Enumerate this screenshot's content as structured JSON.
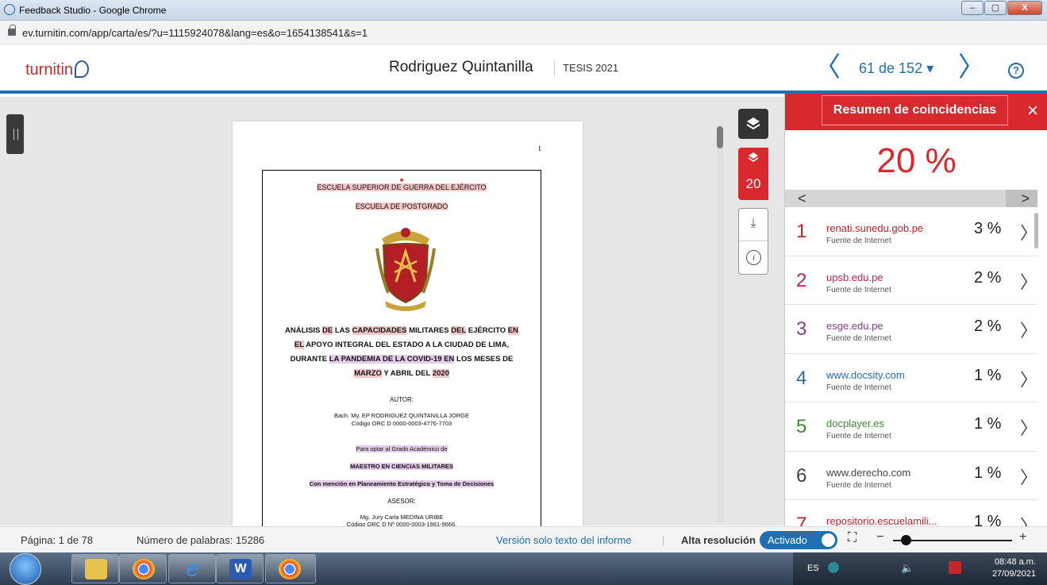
{
  "browser": {
    "window_title": "Feedback Studio - Google Chrome",
    "url": "ev.turnitin.com/app/carta/es/?u=1115924078&lang=es&o=1654138541&s=1",
    "minimize": "–",
    "maximize": "▢",
    "close": "X"
  },
  "header": {
    "logo_text": "turnitin",
    "doc_title": "Rodriguez Quintanilla",
    "doc_subtitle": "TESIS 2021",
    "prev": "〈",
    "next": "〉",
    "page_counter": "61 de 152 ▾",
    "help": "?"
  },
  "document": {
    "page_number": "1",
    "lines": {
      "school": "ESCUELA SUPERIOR DE GUERRA DEL EJÉRCITO",
      "postgrado": "ESCUELA DE POSTGRADO",
      "title1a": "ANÁLISIS ",
      "title1b": "DE",
      "title1c": " LAS ",
      "title1d": "CAPACIDADES",
      "title1e": " MILITARES ",
      "title1f": "DEL",
      "title1g": " EJÉRCITO ",
      "title1h": "EN",
      "title2a": "EL",
      "title2b": " APOYO INTEGRAL DEL ESTADO A LA CIUDAD DE LIMA,",
      "title3a": "DURANTE ",
      "title3b": "LA PANDEMIA DE LA COVID-19 EN",
      "title3c": " LOS MESES DE",
      "title4a": "MARZO",
      "title4b": " Y ABRIL DEL ",
      "title4c": "2020",
      "autor_label": "AUTOR:",
      "autor_name": "Bach. My. EP RODRIGUEZ QUINTANILLA JORGE",
      "autor_orcid": "Código ORC D 0000-0003-4776-7703",
      "para_optar": "Para optar al Grado Académico de",
      "grado": "MAESTRO EN CIENCIAS MILITARES",
      "mencion": "Con mención en Planeamiento Estratégico y Toma de Decisiones",
      "asesor_label": "ASESOR:",
      "asesor_name": "Mg. Jury Carla MEDINA URIBE",
      "asesor_orcid": "Código ORC D Nº 0000-0003-1961-9666."
    }
  },
  "tools": {
    "score": "20",
    "download": "⤓",
    "info": "i"
  },
  "panel": {
    "title": "Resumen de coincidencias",
    "close": "×",
    "overall": "20 %",
    "strip_left": "<",
    "strip_right": ">",
    "matches": [
      {
        "rank": "1",
        "source": "renati.sunedu.gob.pe",
        "type": "Fuente de Internet",
        "percent": "3 %",
        "color": "#c2222b"
      },
      {
        "rank": "2",
        "source": "upsb.edu.pe",
        "type": "Fuente de Internet",
        "percent": "2 %",
        "color": "#c2225e"
      },
      {
        "rank": "3",
        "source": "esge.edu.pe",
        "type": "Fuente de Internet",
        "percent": "2 %",
        "color": "#8a3b8f"
      },
      {
        "rank": "4",
        "source": "www.docsity.com",
        "type": "Fuente de Internet",
        "percent": "1 %",
        "color": "#2b6aa8"
      },
      {
        "rank": "5",
        "source": "docplayer.es",
        "type": "Fuente de Internet",
        "percent": "1 %",
        "color": "#3a8a2e"
      },
      {
        "rank": "6",
        "source": "www.derecho.com",
        "type": "Fuente de Internet",
        "percent": "1 %",
        "color": "#444444"
      },
      {
        "rank": "7",
        "source": "repositorio.escuelamili...",
        "type": "",
        "percent": "1 %",
        "color": "#c2222b"
      }
    ]
  },
  "statusbar": {
    "page": "Página: 1 de 78",
    "words": "Número de palabras: 15286",
    "text_only": "Versión solo texto del informe",
    "separator": "|",
    "high_res": "Alta resolución",
    "toggle": "Activado",
    "zoom_out": "−",
    "zoom_in": "+"
  },
  "taskbar": {
    "lang": "ES",
    "time": "08:48 a.m.",
    "date": "27/09/2021"
  }
}
